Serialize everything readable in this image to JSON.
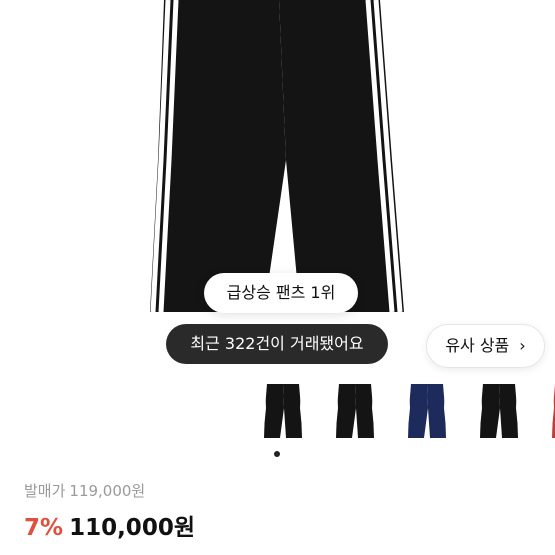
{
  "product": {
    "rank_badge": "급상승 팬츠 1위",
    "trades_badge": "최근 322건이 거래됐어요",
    "similar_button": "유사 상품",
    "similar_chevron": "›"
  },
  "thumbnails": [
    {
      "color": "#141414",
      "stripe": "#ffffff",
      "selected": true
    },
    {
      "color": "#141414",
      "stripe": "#ffffff",
      "selected": false
    },
    {
      "color": "#1d2a5c",
      "stripe": "#ffffff",
      "selected": false
    },
    {
      "color": "#141414",
      "stripe": "#ffffff",
      "selected": false
    },
    {
      "color": "#b8413a",
      "stripe": "#ffffff",
      "selected": false
    }
  ],
  "pricing": {
    "release_label": "발매가",
    "release_price": "119,000원",
    "discount": "7%",
    "price": "110,000원"
  },
  "colors": {
    "discount": "#e0503e",
    "muted": "#9a9a9a"
  }
}
